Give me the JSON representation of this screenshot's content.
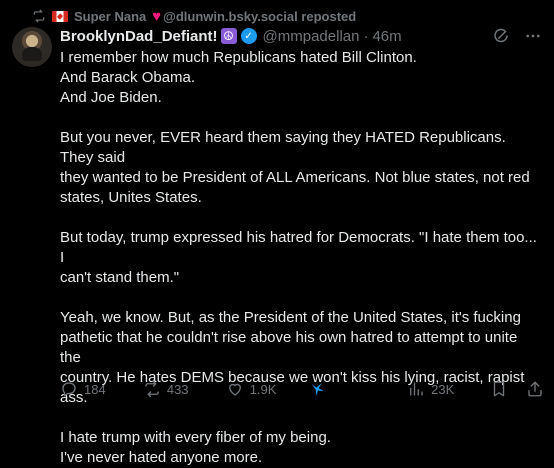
{
  "repost": {
    "text": "Super Nana",
    "handle": "@dlunwin.bsky.social reposted",
    "icon": "repost-icon"
  },
  "author": {
    "display_name": "BrooklynDad_Defiant!",
    "handle": "@mmpadellan",
    "separator": "·",
    "time": "46m"
  },
  "post": {
    "paragraphs": [
      [
        "I remember how much Republicans hated Bill Clinton.",
        "And Barack Obama.",
        "And Joe Biden."
      ],
      [
        "But you never, EVER heard them saying they HATED Republicans. They said",
        "they wanted to be President of ALL Americans. Not blue states, not red",
        "states, Unites States."
      ],
      [
        "But today, trump expressed his hatred for Democrats. \"I hate them too... I",
        "can't stand them.\""
      ],
      [
        "Yeah, we know. But, as the President of the United States, it's fucking",
        "pathetic that he couldn't rise above his own hatred to attempt to unite the",
        "country. He hates DEMS because we won't kiss his lying, racist, rapist ass."
      ],
      [
        "I hate trump with every fiber of my being.",
        "I've never hated anyone more."
      ]
    ]
  },
  "actions": {
    "replies": "184",
    "reposts": "433",
    "likes": "1.9K",
    "views": "23K"
  },
  "colors": {
    "background": "#000000",
    "text": "#e7e9ea",
    "muted": "#71767b",
    "accent": "#1d9bf0",
    "heart": "#f91880"
  }
}
